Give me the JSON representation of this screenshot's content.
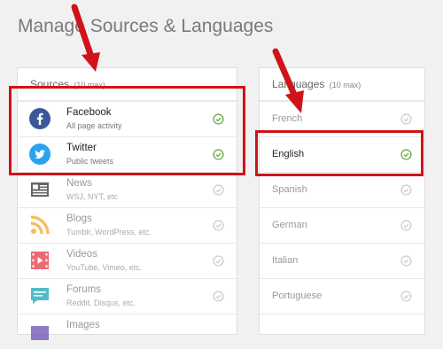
{
  "page": {
    "title": "Manage Sources & Languages"
  },
  "sources": {
    "header": "Sources",
    "header_note": "(10 max)",
    "items": [
      {
        "name": "Facebook",
        "sub": "All page activity",
        "icon": "facebook-icon",
        "selected": true
      },
      {
        "name": "Twitter",
        "sub": "Public tweets",
        "icon": "twitter-icon",
        "selected": true
      },
      {
        "name": "News",
        "sub": "WSJ, NYT, etc",
        "icon": "news-icon",
        "selected": false
      },
      {
        "name": "Blogs",
        "sub": "Tumblr, WordPress, etc.",
        "icon": "rss-icon",
        "selected": false
      },
      {
        "name": "Videos",
        "sub": "YouTube, Vimeo, etc.",
        "icon": "video-icon",
        "selected": false
      },
      {
        "name": "Forums",
        "sub": "Reddit, Disqus, etc.",
        "icon": "forum-icon",
        "selected": false
      },
      {
        "name": "Images",
        "sub": "",
        "icon": "image-icon",
        "selected": false
      }
    ]
  },
  "languages": {
    "header": "Languages",
    "header_note": "(10 max)",
    "items": [
      {
        "name": "French",
        "selected": false
      },
      {
        "name": "English",
        "selected": true
      },
      {
        "name": "Spanish",
        "selected": false
      },
      {
        "name": "German",
        "selected": false
      },
      {
        "name": "Italian",
        "selected": false
      },
      {
        "name": "Portuguese",
        "selected": false
      }
    ]
  },
  "colors": {
    "highlight": "#d0121b",
    "check_on": "#6ab04c",
    "check_off": "#cfcfcf",
    "facebook": "#3b5998",
    "twitter": "#2aa3ef",
    "rss": "#f5a623",
    "video": "#e63946",
    "forum": "#1aa3b8"
  }
}
